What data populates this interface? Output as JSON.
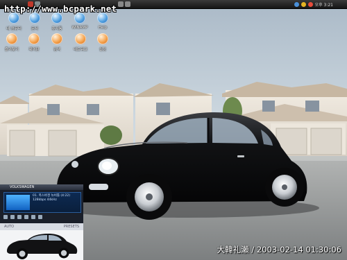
{
  "watermark": "http://www.bcpark.net",
  "photo_caption": "大韓礼瀬 / 2003-02-14 01:30:06",
  "tray": {
    "clock": "오후 3:21"
  },
  "desktop_icons": [
    {
      "label": "내 컴퓨터",
      "icon": "computer-icon",
      "color": "blue"
    },
    {
      "label": "문서",
      "icon": "documents-icon",
      "color": "blue"
    },
    {
      "label": "휴지통",
      "icon": "recycle-bin-icon",
      "color": "blue"
    },
    {
      "label": "WINAMP",
      "icon": "winamp-icon",
      "color": "blue"
    },
    {
      "label": "Help",
      "icon": "help-icon",
      "color": "blue"
    },
    {
      "label": "즐겨찾기",
      "icon": "favorites-icon",
      "color": "orange"
    },
    {
      "label": "제어판",
      "icon": "control-panel-icon",
      "color": "orange"
    },
    {
      "label": "검색",
      "icon": "search-icon",
      "color": "orange"
    },
    {
      "label": "네트워크",
      "icon": "network-icon",
      "color": "orange"
    },
    {
      "label": "설정",
      "icon": "settings-icon",
      "color": "orange"
    }
  ],
  "player": {
    "title": "VOLKSWAGEN",
    "track_line1": "01. 폭스바겐 뉴비틀 (4:22)",
    "track_line2": "128kbps 44kHz",
    "nav_left": "AUTO",
    "nav_right": "PRESETS"
  },
  "colors": {
    "sky_top": "#a9b8c6",
    "accent_blue": "#4f9fe0",
    "car_body": "#0b0b0d"
  }
}
